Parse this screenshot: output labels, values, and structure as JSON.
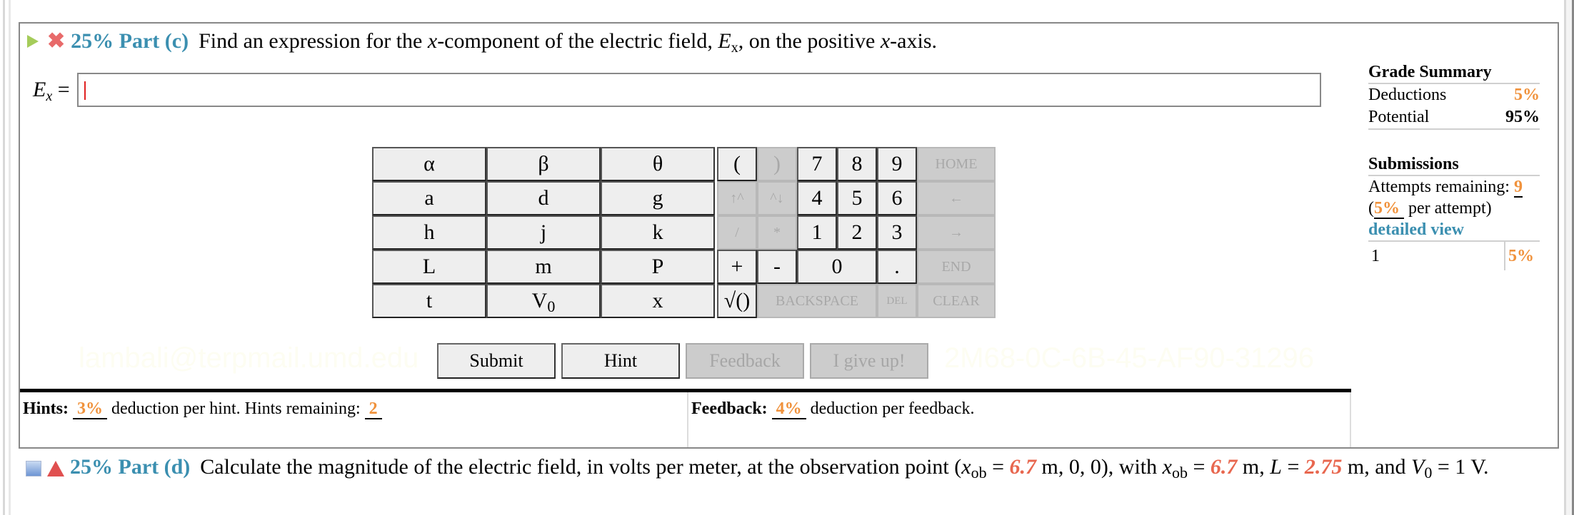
{
  "part_c": {
    "icons": [
      "play-icon",
      "incorrect-x-icon"
    ],
    "percent": "25%",
    "label": "Part (c)",
    "prompt_before": "Find an expression for the ",
    "prompt_x": "x",
    "prompt_mid": "-component of the electric field, ",
    "prompt_E": "E",
    "prompt_E_sub": "x",
    "prompt_after": ", on the positive ",
    "prompt_x2": "x",
    "prompt_end": "-axis."
  },
  "answer": {
    "label_E": "E",
    "label_sub": "x",
    "label_eq": " =",
    "value": ""
  },
  "keypad": {
    "variables": [
      "α",
      "β",
      "θ",
      "a",
      "d",
      "g",
      "h",
      "j",
      "k",
      "L",
      "m",
      "P",
      "t",
      "V0",
      "x"
    ],
    "ops_row1": [
      "(",
      ")",
      "7",
      "8",
      "9",
      "HOME"
    ],
    "ops_row2": [
      "↑^",
      "^↓",
      "4",
      "5",
      "6",
      "←"
    ],
    "ops_row3": [
      "/",
      "*",
      "1",
      "2",
      "3",
      "→"
    ],
    "ops_row4": [
      "+",
      "-",
      "0",
      ".",
      "END"
    ],
    "ops_row5": [
      "√()",
      "BACKSPACE",
      "DEL",
      "CLEAR"
    ]
  },
  "buttons": {
    "submit": "Submit",
    "hint": "Hint",
    "feedback": "Feedback",
    "give_up": "I give up!"
  },
  "watermarks": [
    "lambali@terpmail.umd.edu",
    "2M68-0C-6B-45-AF90-31296"
  ],
  "hints": {
    "label": "Hints:",
    "deduction": "3%",
    "text": " deduction per hint. Hints remaining: ",
    "remaining": "2"
  },
  "feedback": {
    "label": "Feedback:",
    "deduction": "4%",
    "text": " deduction per feedback."
  },
  "grade_summary": {
    "title": "Grade Summary",
    "deductions_label": "Deductions",
    "deductions_value": "5%",
    "potential_label": "Potential",
    "potential_value": "95%"
  },
  "submissions": {
    "title": "Submissions",
    "attempts_label": "Attempts remaining: ",
    "attempts_value": "9",
    "per_attempt_open": "(",
    "per_attempt_value": "5%",
    "per_attempt_text": " per attempt)",
    "detailed_view": "detailed view",
    "history": [
      {
        "attempt": "1",
        "deduction": "5%"
      }
    ]
  },
  "part_d": {
    "percent": "25%",
    "label": "Part (d)",
    "t1": "Calculate the magnitude of the electric field, in volts per meter, at the observation point (",
    "x": "x",
    "ob": "ob",
    "eq": " = ",
    "xob_value": "6.7",
    "t2": " m, 0, 0), with ",
    "t3": " m, ",
    "L": "L",
    "L_value": "2.75",
    "t4": " m, and ",
    "V": "V",
    "V_sub": "0",
    "t5": " = 1 V."
  },
  "colors": {
    "accent_blue": "#3b8fb0",
    "orange": "#f0923c",
    "red_value": "#e8674f"
  }
}
